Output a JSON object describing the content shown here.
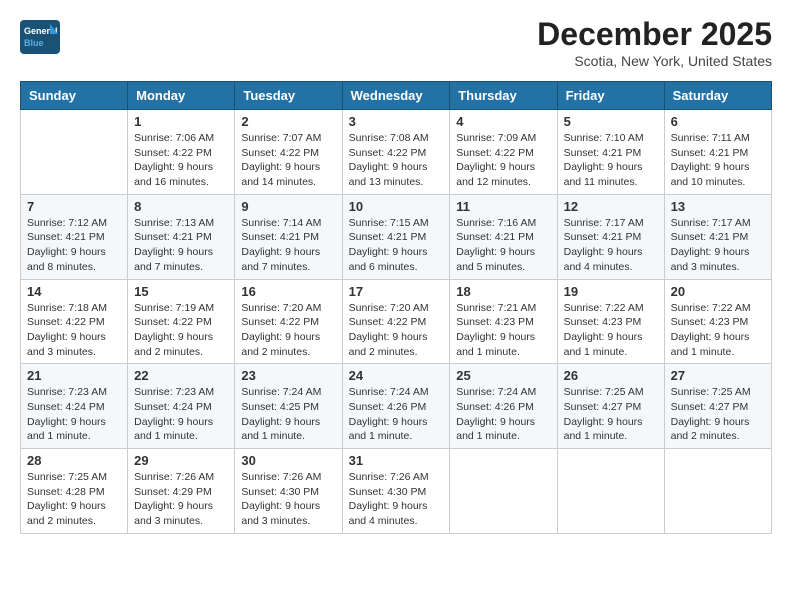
{
  "header": {
    "logo_text_general": "General",
    "logo_text_blue": "Blue",
    "month": "December 2025",
    "location": "Scotia, New York, United States"
  },
  "weekdays": [
    "Sunday",
    "Monday",
    "Tuesday",
    "Wednesday",
    "Thursday",
    "Friday",
    "Saturday"
  ],
  "weeks": [
    [
      {
        "day": "",
        "info": ""
      },
      {
        "day": "1",
        "info": "Sunrise: 7:06 AM\nSunset: 4:22 PM\nDaylight: 9 hours\nand 16 minutes."
      },
      {
        "day": "2",
        "info": "Sunrise: 7:07 AM\nSunset: 4:22 PM\nDaylight: 9 hours\nand 14 minutes."
      },
      {
        "day": "3",
        "info": "Sunrise: 7:08 AM\nSunset: 4:22 PM\nDaylight: 9 hours\nand 13 minutes."
      },
      {
        "day": "4",
        "info": "Sunrise: 7:09 AM\nSunset: 4:22 PM\nDaylight: 9 hours\nand 12 minutes."
      },
      {
        "day": "5",
        "info": "Sunrise: 7:10 AM\nSunset: 4:21 PM\nDaylight: 9 hours\nand 11 minutes."
      },
      {
        "day": "6",
        "info": "Sunrise: 7:11 AM\nSunset: 4:21 PM\nDaylight: 9 hours\nand 10 minutes."
      }
    ],
    [
      {
        "day": "7",
        "info": "Sunrise: 7:12 AM\nSunset: 4:21 PM\nDaylight: 9 hours\nand 8 minutes."
      },
      {
        "day": "8",
        "info": "Sunrise: 7:13 AM\nSunset: 4:21 PM\nDaylight: 9 hours\nand 7 minutes."
      },
      {
        "day": "9",
        "info": "Sunrise: 7:14 AM\nSunset: 4:21 PM\nDaylight: 9 hours\nand 7 minutes."
      },
      {
        "day": "10",
        "info": "Sunrise: 7:15 AM\nSunset: 4:21 PM\nDaylight: 9 hours\nand 6 minutes."
      },
      {
        "day": "11",
        "info": "Sunrise: 7:16 AM\nSunset: 4:21 PM\nDaylight: 9 hours\nand 5 minutes."
      },
      {
        "day": "12",
        "info": "Sunrise: 7:17 AM\nSunset: 4:21 PM\nDaylight: 9 hours\nand 4 minutes."
      },
      {
        "day": "13",
        "info": "Sunrise: 7:17 AM\nSunset: 4:21 PM\nDaylight: 9 hours\nand 3 minutes."
      }
    ],
    [
      {
        "day": "14",
        "info": "Sunrise: 7:18 AM\nSunset: 4:22 PM\nDaylight: 9 hours\nand 3 minutes."
      },
      {
        "day": "15",
        "info": "Sunrise: 7:19 AM\nSunset: 4:22 PM\nDaylight: 9 hours\nand 2 minutes."
      },
      {
        "day": "16",
        "info": "Sunrise: 7:20 AM\nSunset: 4:22 PM\nDaylight: 9 hours\nand 2 minutes."
      },
      {
        "day": "17",
        "info": "Sunrise: 7:20 AM\nSunset: 4:22 PM\nDaylight: 9 hours\nand 2 minutes."
      },
      {
        "day": "18",
        "info": "Sunrise: 7:21 AM\nSunset: 4:23 PM\nDaylight: 9 hours\nand 1 minute."
      },
      {
        "day": "19",
        "info": "Sunrise: 7:22 AM\nSunset: 4:23 PM\nDaylight: 9 hours\nand 1 minute."
      },
      {
        "day": "20",
        "info": "Sunrise: 7:22 AM\nSunset: 4:23 PM\nDaylight: 9 hours\nand 1 minute."
      }
    ],
    [
      {
        "day": "21",
        "info": "Sunrise: 7:23 AM\nSunset: 4:24 PM\nDaylight: 9 hours\nand 1 minute."
      },
      {
        "day": "22",
        "info": "Sunrise: 7:23 AM\nSunset: 4:24 PM\nDaylight: 9 hours\nand 1 minute."
      },
      {
        "day": "23",
        "info": "Sunrise: 7:24 AM\nSunset: 4:25 PM\nDaylight: 9 hours\nand 1 minute."
      },
      {
        "day": "24",
        "info": "Sunrise: 7:24 AM\nSunset: 4:26 PM\nDaylight: 9 hours\nand 1 minute."
      },
      {
        "day": "25",
        "info": "Sunrise: 7:24 AM\nSunset: 4:26 PM\nDaylight: 9 hours\nand 1 minute."
      },
      {
        "day": "26",
        "info": "Sunrise: 7:25 AM\nSunset: 4:27 PM\nDaylight: 9 hours\nand 1 minute."
      },
      {
        "day": "27",
        "info": "Sunrise: 7:25 AM\nSunset: 4:27 PM\nDaylight: 9 hours\nand 2 minutes."
      }
    ],
    [
      {
        "day": "28",
        "info": "Sunrise: 7:25 AM\nSunset: 4:28 PM\nDaylight: 9 hours\nand 2 minutes."
      },
      {
        "day": "29",
        "info": "Sunrise: 7:26 AM\nSunset: 4:29 PM\nDaylight: 9 hours\nand 3 minutes."
      },
      {
        "day": "30",
        "info": "Sunrise: 7:26 AM\nSunset: 4:30 PM\nDaylight: 9 hours\nand 3 minutes."
      },
      {
        "day": "31",
        "info": "Sunrise: 7:26 AM\nSunset: 4:30 PM\nDaylight: 9 hours\nand 4 minutes."
      },
      {
        "day": "",
        "info": ""
      },
      {
        "day": "",
        "info": ""
      },
      {
        "day": "",
        "info": ""
      }
    ]
  ]
}
